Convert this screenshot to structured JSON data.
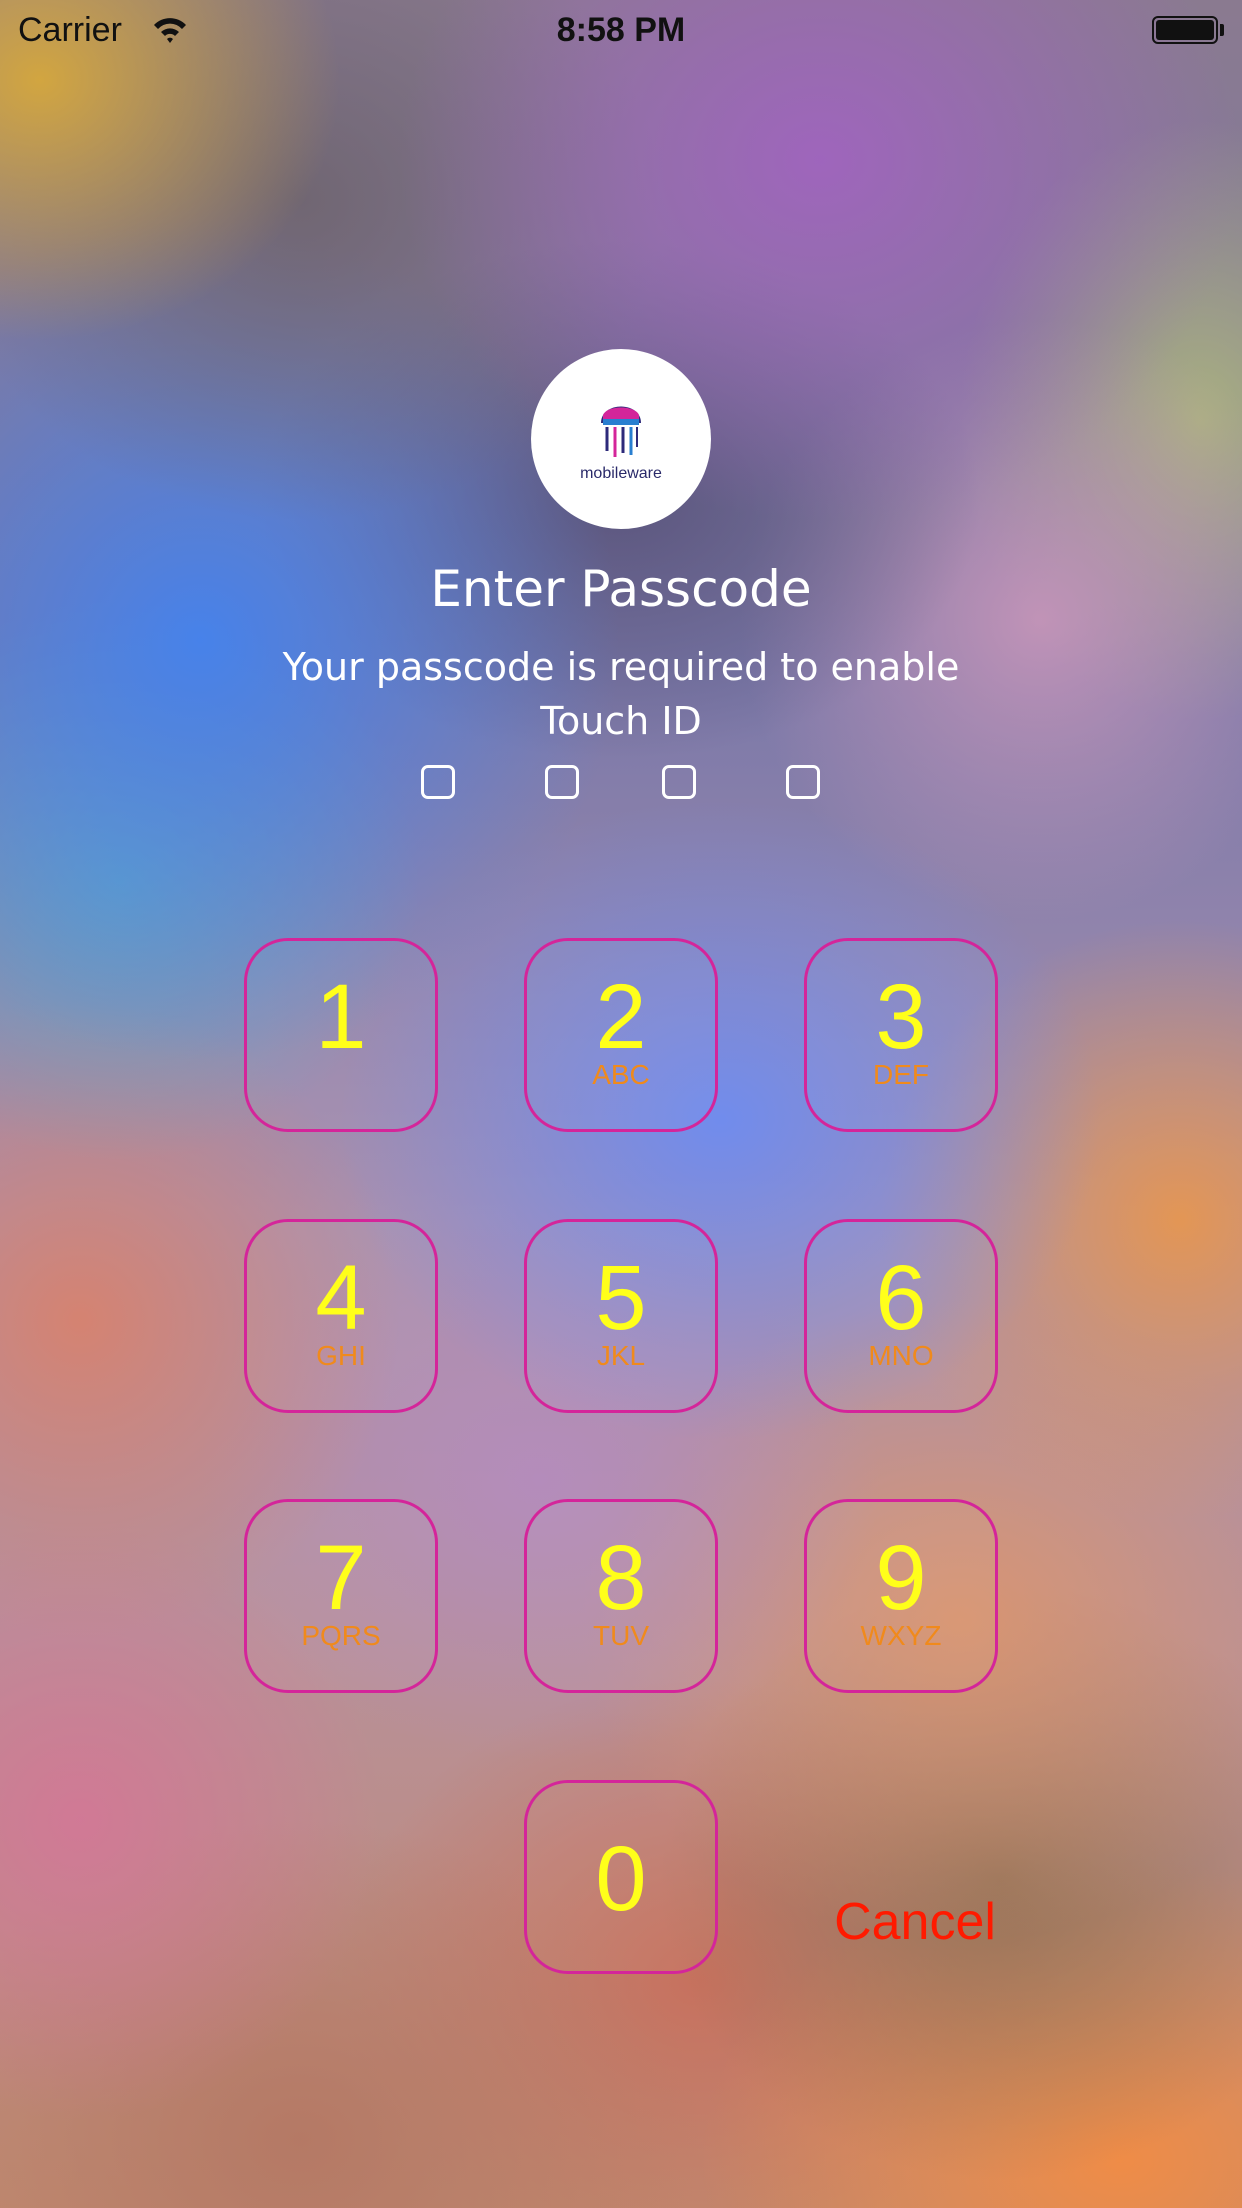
{
  "status_bar": {
    "carrier": "Carrier",
    "time": "8:58 PM",
    "wifi_icon": "wifi-icon",
    "battery_icon": "battery-icon"
  },
  "logo": {
    "text": "mobileware",
    "icon": "jellyfish-icon"
  },
  "title": "Enter Passcode",
  "subtitle": "Your passcode is required to enable Touch ID",
  "passcode_length": 4,
  "keypad": {
    "keys": [
      {
        "digit": "1",
        "letters": ""
      },
      {
        "digit": "2",
        "letters": "ABC"
      },
      {
        "digit": "3",
        "letters": "DEF"
      },
      {
        "digit": "4",
        "letters": "GHI"
      },
      {
        "digit": "5",
        "letters": "JKL"
      },
      {
        "digit": "6",
        "letters": "MNO"
      },
      {
        "digit": "7",
        "letters": "PQRS"
      },
      {
        "digit": "8",
        "letters": "TUV"
      },
      {
        "digit": "9",
        "letters": "WXYZ"
      },
      {
        "digit": "0",
        "letters": ""
      }
    ]
  },
  "cancel_label": "Cancel",
  "colors": {
    "key_border": "#d4259a",
    "digit": "#ffff1a",
    "letters": "#f08a1c",
    "cancel": "#ff1a00"
  }
}
